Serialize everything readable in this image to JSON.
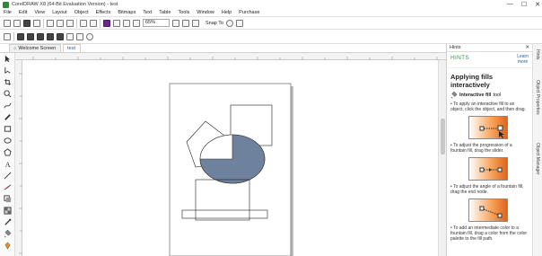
{
  "window": {
    "title": "CorelDRAW X8 (64-Bit Evaluation Version) - test",
    "controls": [
      "—",
      "☐",
      "✕"
    ]
  },
  "menu": [
    "File",
    "Edit",
    "View",
    "Layout",
    "Object",
    "Effects",
    "Bitmaps",
    "Text",
    "Table",
    "Tools",
    "Window",
    "Help",
    "Purchase"
  ],
  "toolbar": {
    "zoom": "65%",
    "snap_to": "Snap To"
  },
  "tabs": [
    "Welcome Screen",
    "test"
  ],
  "hints": {
    "panel_title": "Hints",
    "banner": "HINTS",
    "learn_more": "Learn\nmore",
    "heading": "Applying fills interactively",
    "tool_name": "Interactive fill",
    "tool_suffix": "tool",
    "p1": "To apply an interactive fill to an object, click the object, and then drag.",
    "p2": "To adjust the progression of a fountain fill, drag the slider.",
    "p3": "To adjust the angle of a fountain fill, drag the end node.",
    "p4": "To add an intermediate color to a fountain fill, drag a color from the color palette to the fill path."
  },
  "dockers": [
    "Hints",
    "Object Properties",
    "Object Manager"
  ],
  "colors": {
    "fill_shape": "#6a7e9a",
    "hints_green": "#2e9a4c",
    "accent": "#1a5fb4"
  }
}
